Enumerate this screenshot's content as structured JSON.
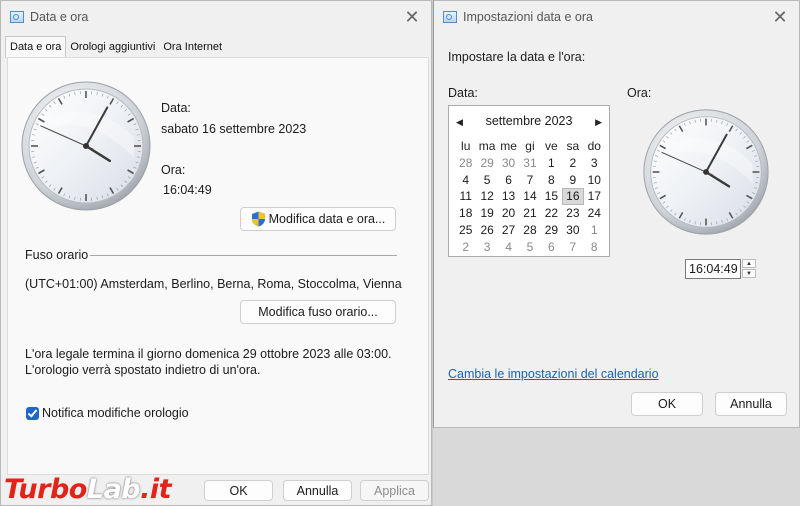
{
  "window1": {
    "title": "Data e ora",
    "tabs": [
      "Data e ora",
      "Orologi aggiuntivi",
      "Ora Internet"
    ],
    "date_label": "Data:",
    "date_value": "sabato 16 settembre 2023",
    "time_label": "Ora:",
    "time_value": "16:04:49",
    "change_datetime_button": "Modifica data e ora...",
    "timezone_heading": "Fuso orario",
    "timezone_value": "(UTC+01:00) Amsterdam, Berlino, Berna, Roma, Stoccolma, Vienna",
    "change_timezone_button": "Modifica fuso orario...",
    "dst_line1": "L'ora legale termina il giorno domenica 29 ottobre 2023 alle 03:00.",
    "dst_line2": "L'orologio verrà spostato indietro di un'ora.",
    "notify_label": "Notifica modifiche orologio",
    "notify_checked": true,
    "ok_button": "OK",
    "cancel_button": "Annulla",
    "apply_button": "Applica"
  },
  "window2": {
    "title": "Impostazioni data e ora",
    "instruction": "Impostare la data e l'ora:",
    "date_label": "Data:",
    "time_label": "Ora:",
    "calendar": {
      "month": "settembre 2023",
      "prev_glyph": "◀",
      "next_glyph": "▶",
      "weekdays": [
        "lu",
        "ma",
        "me",
        "gi",
        "ve",
        "sa",
        "do"
      ],
      "weeks": [
        [
          "28",
          "29",
          "30",
          "31",
          "1",
          "2",
          "3"
        ],
        [
          "4",
          "5",
          "6",
          "7",
          "8",
          "9",
          "10"
        ],
        [
          "11",
          "12",
          "13",
          "14",
          "15",
          "16",
          "17"
        ],
        [
          "18",
          "19",
          "20",
          "21",
          "22",
          "23",
          "24"
        ],
        [
          "25",
          "26",
          "27",
          "28",
          "29",
          "30",
          "1"
        ],
        [
          "2",
          "3",
          "4",
          "5",
          "6",
          "7",
          "8"
        ]
      ],
      "selected_day": "16"
    },
    "time_value": "16:04:49",
    "calendar_link": "Cambia le impostazioni del calendario",
    "ok_button": "OK",
    "cancel_button": "Annulla"
  },
  "clock_time": {
    "hours": 16,
    "minutes": 4,
    "seconds": 49
  },
  "watermark": {
    "part1": "Turbo",
    "part2": "Lab",
    "part3": ".it"
  },
  "colors": {
    "accent": "#1e66c9",
    "link": "#1763b8",
    "watermark_red": "#e2231a"
  }
}
